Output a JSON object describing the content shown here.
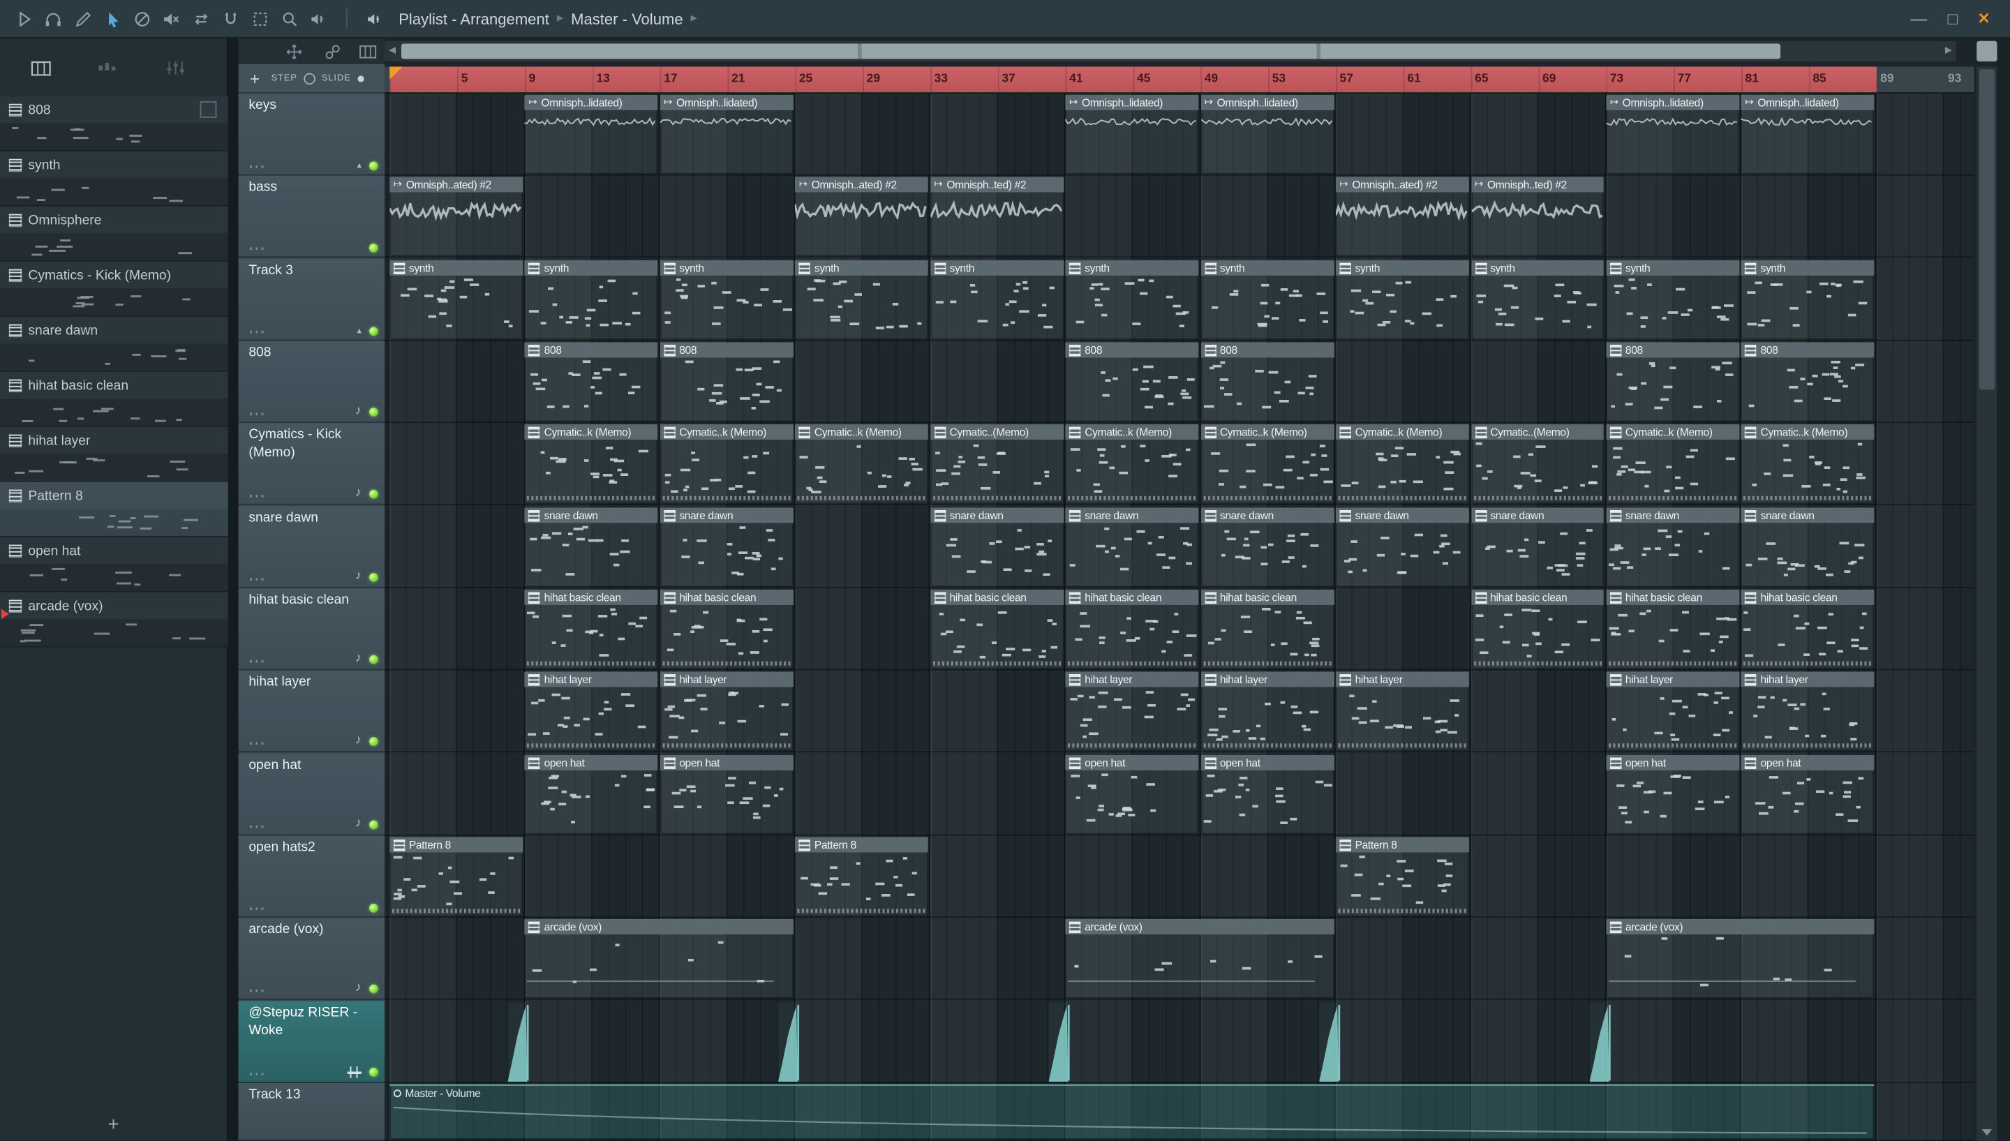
{
  "titlebar": {
    "icons": [
      "play",
      "headphones",
      "draw",
      "cursor",
      "slip",
      "mute",
      "swap",
      "magnet",
      "zoom-frame",
      "zoom",
      "volume",
      "speaker"
    ],
    "breadcrumb": [
      {
        "label": "Playlist - Arrangement"
      },
      {
        "label": "Master - Volume"
      }
    ],
    "separator": "▸",
    "window_controls": {
      "minimize": "—",
      "maximize": "□",
      "close": "×"
    }
  },
  "pattern_panel": {
    "add_label": "+",
    "items": [
      {
        "name": "808"
      },
      {
        "name": "synth"
      },
      {
        "name": "Omnisphere"
      },
      {
        "name": "Cymatics - Kick (Memo)"
      },
      {
        "name": "snare dawn"
      },
      {
        "name": "hihat basic clean"
      },
      {
        "name": "hihat layer"
      },
      {
        "name": "Pattern 8",
        "selected": true
      },
      {
        "name": "open hat"
      },
      {
        "name": "arcade (vox)",
        "playing": true
      }
    ]
  },
  "playlist": {
    "add_label": "+",
    "step_label": "STEP",
    "slide_label": "SLIDE",
    "tool_icons": [
      "slide-tool",
      "link-tool",
      "piano-tool"
    ],
    "ruler": {
      "numbers": [
        5,
        9,
        13,
        17,
        21,
        25,
        29,
        33,
        37,
        41,
        45,
        49,
        53,
        57,
        61,
        65,
        69,
        73,
        77,
        81,
        85,
        89,
        93
      ],
      "red_end_bar": 89
    },
    "tracks": [
      {
        "name": "keys",
        "header_icons": [
          "collapse",
          "led"
        ],
        "clip_type": "audio",
        "clip_style": "wave-thin",
        "clips": [
          {
            "label": "Omnisph..lidated)",
            "bar": 9,
            "len": 8
          },
          {
            "label": "Omnisph..lidated)",
            "bar": 17,
            "len": 8
          },
          {
            "label": "Omnisph..lidated)",
            "bar": 41,
            "len": 8
          },
          {
            "label": "Omnisph..lidated)",
            "bar": 49,
            "len": 8
          },
          {
            "label": "Omnisph..lidated)",
            "bar": 73,
            "len": 8
          },
          {
            "label": "Omnisph..lidated)",
            "bar": 81,
            "len": 8
          }
        ]
      },
      {
        "name": "bass",
        "header_icons": [
          "led"
        ],
        "clip_type": "audio",
        "clip_style": "wave-thick",
        "clips": [
          {
            "label": "Omnisph..ated) #2",
            "bar": 1,
            "len": 8
          },
          {
            "label": "Omnisph..ated) #2",
            "bar": 25,
            "len": 8
          },
          {
            "label": "Omnisph..ted) #2",
            "bar": 33,
            "len": 8
          },
          {
            "label": "Omnisph..ated) #2",
            "bar": 57,
            "len": 8
          },
          {
            "label": "Omnisph..ted) #2",
            "bar": 65,
            "len": 8
          }
        ]
      },
      {
        "name": "Track 3",
        "header_icons": [
          "collapse",
          "led"
        ],
        "clip_type": "midi",
        "clip_style": "notes",
        "clips": [
          {
            "label": "synth",
            "bar": 1,
            "len": 8
          },
          {
            "label": "synth",
            "bar": 9,
            "len": 8
          },
          {
            "label": "synth",
            "bar": 17,
            "len": 8
          },
          {
            "label": "synth",
            "bar": 25,
            "len": 8
          },
          {
            "label": "synth",
            "bar": 33,
            "len": 8
          },
          {
            "label": "synth",
            "bar": 41,
            "len": 8
          },
          {
            "label": "synth",
            "bar": 49,
            "len": 8
          },
          {
            "label": "synth",
            "bar": 57,
            "len": 8
          },
          {
            "label": "synth",
            "bar": 65,
            "len": 8
          },
          {
            "label": "synth",
            "bar": 73,
            "len": 8
          },
          {
            "label": "synth",
            "bar": 81,
            "len": 8
          }
        ]
      },
      {
        "name": "808",
        "header_icons": [
          "note",
          "led"
        ],
        "clip_type": "midi",
        "clip_style": "notes",
        "clips": [
          {
            "label": "808",
            "bar": 9,
            "len": 8
          },
          {
            "label": "808",
            "bar": 17,
            "len": 8
          },
          {
            "label": "808",
            "bar": 41,
            "len": 8
          },
          {
            "label": "808",
            "bar": 49,
            "len": 8
          },
          {
            "label": "808",
            "bar": 73,
            "len": 8
          },
          {
            "label": "808",
            "bar": 81,
            "len": 8
          }
        ]
      },
      {
        "name": "Cymatics - Kick (Memo)",
        "header_icons": [
          "note",
          "led"
        ],
        "clip_type": "midi",
        "clip_style": "notes-ticks",
        "clips": [
          {
            "label": "Cymatic..k (Memo)",
            "bar": 9,
            "len": 8
          },
          {
            "label": "Cymatic..k (Memo)",
            "bar": 17,
            "len": 8
          },
          {
            "label": "Cymatic..k (Memo)",
            "bar": 25,
            "len": 8
          },
          {
            "label": "Cymatic..(Memo)",
            "bar": 33,
            "len": 8
          },
          {
            "label": "Cymatic..k (Memo)",
            "bar": 41,
            "len": 8
          },
          {
            "label": "Cymatic..k (Memo)",
            "bar": 49,
            "len": 8
          },
          {
            "label": "Cymatic..k (Memo)",
            "bar": 57,
            "len": 8
          },
          {
            "label": "Cymatic..(Memo)",
            "bar": 65,
            "len": 8
          },
          {
            "label": "Cymatic..k (Memo)",
            "bar": 73,
            "len": 8
          },
          {
            "label": "Cymatic..k (Memo)",
            "bar": 81,
            "len": 8
          }
        ]
      },
      {
        "name": "snare dawn",
        "header_icons": [
          "note",
          "led"
        ],
        "clip_type": "midi",
        "clip_style": "notes",
        "clips": [
          {
            "label": "snare dawn",
            "bar": 9,
            "len": 8
          },
          {
            "label": "snare dawn",
            "bar": 17,
            "len": 8
          },
          {
            "label": "snare dawn",
            "bar": 33,
            "len": 8
          },
          {
            "label": "snare dawn",
            "bar": 41,
            "len": 8
          },
          {
            "label": "snare dawn",
            "bar": 49,
            "len": 8
          },
          {
            "label": "snare dawn",
            "bar": 57,
            "len": 8
          },
          {
            "label": "snare dawn",
            "bar": 65,
            "len": 8
          },
          {
            "label": "snare dawn",
            "bar": 73,
            "len": 8
          },
          {
            "label": "snare dawn",
            "bar": 81,
            "len": 8
          }
        ]
      },
      {
        "name": "hihat basic clean",
        "header_icons": [
          "note",
          "led"
        ],
        "clip_type": "midi",
        "clip_style": "notes-ticks",
        "clips": [
          {
            "label": "hihat basic clean",
            "bar": 9,
            "len": 8
          },
          {
            "label": "hihat basic clean",
            "bar": 17,
            "len": 8
          },
          {
            "label": "hihat basic clean",
            "bar": 33,
            "len": 8
          },
          {
            "label": "hihat basic clean",
            "bar": 41,
            "len": 8
          },
          {
            "label": "hihat basic clean",
            "bar": 49,
            "len": 8
          },
          {
            "label": "hihat basic clean",
            "bar": 65,
            "len": 8
          },
          {
            "label": "hihat basic clean",
            "bar": 73,
            "len": 8
          },
          {
            "label": "hihat basic clean",
            "bar": 81,
            "len": 8
          }
        ]
      },
      {
        "name": "hihat layer",
        "header_icons": [
          "note",
          "led"
        ],
        "clip_type": "midi",
        "clip_style": "notes-ticks",
        "clips": [
          {
            "label": "hihat layer",
            "bar": 9,
            "len": 8
          },
          {
            "label": "hihat layer",
            "bar": 17,
            "len": 8
          },
          {
            "label": "hihat layer",
            "bar": 41,
            "len": 8
          },
          {
            "label": "hihat layer",
            "bar": 49,
            "len": 8
          },
          {
            "label": "hihat layer",
            "bar": 57,
            "len": 8
          },
          {
            "label": "hihat layer",
            "bar": 73,
            "len": 8
          },
          {
            "label": "hihat layer",
            "bar": 81,
            "len": 8
          }
        ]
      },
      {
        "name": "open hat",
        "header_icons": [
          "note",
          "led"
        ],
        "clip_type": "midi",
        "clip_style": "notes",
        "clips": [
          {
            "label": "open hat",
            "bar": 9,
            "len": 8
          },
          {
            "label": "open hat",
            "bar": 17,
            "len": 8
          },
          {
            "label": "open hat",
            "bar": 41,
            "len": 8
          },
          {
            "label": "open hat",
            "bar": 49,
            "len": 8
          },
          {
            "label": "open hat",
            "bar": 73,
            "len": 8
          },
          {
            "label": "open hat",
            "bar": 81,
            "len": 8
          }
        ]
      },
      {
        "name": "open hats2",
        "header_icons": [
          "led"
        ],
        "clip_type": "midi",
        "clip_style": "notes-ticks",
        "clips": [
          {
            "label": "Pattern 8",
            "bar": 1,
            "len": 8
          },
          {
            "label": "Pattern 8",
            "bar": 25,
            "len": 8
          },
          {
            "label": "Pattern 8",
            "bar": 57,
            "len": 8
          }
        ]
      },
      {
        "name": "arcade (vox)",
        "header_icons": [
          "note",
          "led"
        ],
        "clip_type": "midi",
        "clip_style": "sparse",
        "clips": [
          {
            "label": "arcade (vox)",
            "bar": 9,
            "len": 16
          },
          {
            "label": "arcade (vox)",
            "bar": 41,
            "len": 16
          },
          {
            "label": "arcade (vox)",
            "bar": 73,
            "len": 16
          }
        ]
      },
      {
        "name": "@Stepuz RISER - Woke",
        "selected": true,
        "header_icons": [
          "mixer",
          "led"
        ],
        "clip_type": "riser",
        "clip_style": "riser",
        "clips": [
          {
            "label": "",
            "bar": 8,
            "len": 1.4
          },
          {
            "label": "",
            "bar": 24,
            "len": 1.4
          },
          {
            "label": "",
            "bar": 40,
            "len": 1.4
          },
          {
            "label": "",
            "bar": 56,
            "len": 1.4
          },
          {
            "label": "",
            "bar": 72,
            "len": 1.4
          }
        ]
      },
      {
        "name": "Track 13",
        "header_icons": [],
        "clip_type": "auto",
        "clip_style": "auto",
        "clips": [
          {
            "label": "Master - Volume",
            "bar": 1,
            "len": 88
          }
        ]
      }
    ]
  },
  "colors": {
    "ruler_red": "#c25b5f",
    "led_green": "#8ee04e",
    "automation_teal": "#6fb9b6",
    "riser_teal": "#88d1ce",
    "track_header": "#42525b",
    "selected_track": "#2f6f6f",
    "close_button": "#f08c1e"
  }
}
